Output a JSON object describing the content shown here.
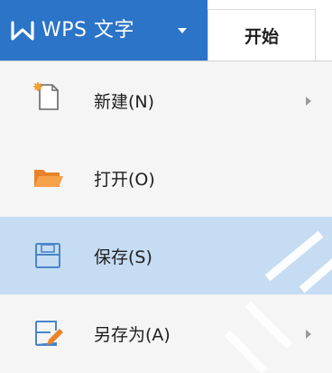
{
  "app": {
    "name": "WPS 文字",
    "logo_icon": "wps-writer-logo-icon",
    "dropdown_icon": "caret-down-icon",
    "accent_color": "#2b74c8"
  },
  "tabs": [
    {
      "label": "开始"
    }
  ],
  "menu": {
    "items": [
      {
        "label": "新建(N)",
        "icon": "new-document-icon",
        "has_submenu": true,
        "selected": false
      },
      {
        "label": "打开(O)",
        "icon": "open-folder-icon",
        "has_submenu": false,
        "selected": false
      },
      {
        "label": "保存(S)",
        "icon": "save-icon",
        "has_submenu": false,
        "selected": true
      },
      {
        "label": "另存为(A)",
        "icon": "save-as-icon",
        "has_submenu": true,
        "selected": false
      }
    ],
    "selected_color": "#c5dcf3"
  }
}
